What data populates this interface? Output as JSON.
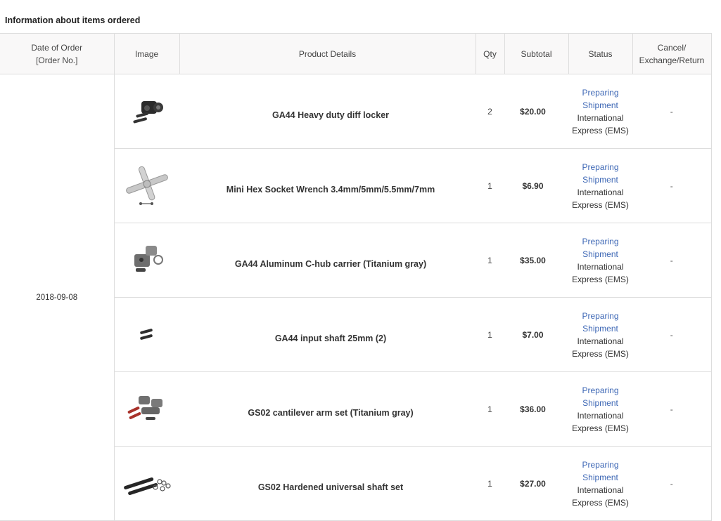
{
  "section_title": "Information about items ordered",
  "headers": {
    "date": "Date of Order",
    "order_no": "[Order No.]",
    "image": "Image",
    "details": "Product Details",
    "qty": "Qty",
    "subtotal": "Subtotal",
    "status": "Status",
    "cancel_1": "Cancel/",
    "cancel_2": "Exchange/Return"
  },
  "order_date": "2018-09-08",
  "items": [
    {
      "name": "GA44 Heavy duty diff locker",
      "qty": "2",
      "subtotal": "$20.00",
      "status_1": "Preparing",
      "status_2": "Shipment",
      "ship_1": "International",
      "ship_2": "Express (EMS)",
      "cancel": "-",
      "image_icon": "diff-locker-image"
    },
    {
      "name": "Mini Hex Socket Wrench 3.4mm/5mm/5.5mm/7mm",
      "qty": "1",
      "subtotal": "$6.90",
      "status_1": "Preparing",
      "status_2": "Shipment",
      "ship_1": "International",
      "ship_2": "Express (EMS)",
      "cancel": "-",
      "image_icon": "cross-wrench-image"
    },
    {
      "name": "GA44 Aluminum C-hub carrier (Titanium gray)",
      "qty": "1",
      "subtotal": "$35.00",
      "status_1": "Preparing",
      "status_2": "Shipment",
      "ship_1": "International",
      "ship_2": "Express (EMS)",
      "cancel": "-",
      "image_icon": "c-hub-carrier-image"
    },
    {
      "name": "GA44 input shaft 25mm (2)",
      "qty": "1",
      "subtotal": "$7.00",
      "status_1": "Preparing",
      "status_2": "Shipment",
      "ship_1": "International",
      "ship_2": "Express (EMS)",
      "cancel": "-",
      "image_icon": "input-shaft-image"
    },
    {
      "name": "GS02 cantilever arm set (Titanium gray)",
      "qty": "1",
      "subtotal": "$36.00",
      "status_1": "Preparing",
      "status_2": "Shipment",
      "ship_1": "International",
      "ship_2": "Express (EMS)",
      "cancel": "-",
      "image_icon": "cantilever-arm-image"
    },
    {
      "name": "GS02 Hardened universal shaft set",
      "qty": "1",
      "subtotal": "$27.00",
      "status_1": "Preparing",
      "status_2": "Shipment",
      "ship_1": "International",
      "ship_2": "Express (EMS)",
      "cancel": "-",
      "image_icon": "universal-shaft-image"
    }
  ],
  "colors": {
    "status_link": "#3d67b5",
    "border": "#dddddd",
    "header_bg": "#f9f8f8"
  }
}
